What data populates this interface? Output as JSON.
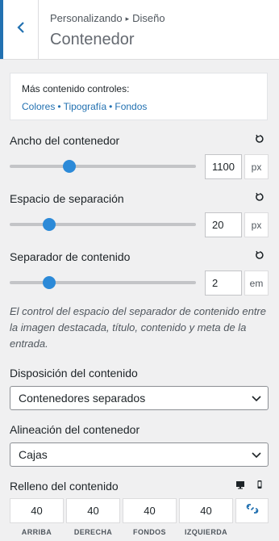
{
  "header": {
    "breadcrumb_parent": "Personalizando",
    "breadcrumb_child": "Diseño",
    "title": "Contenedor"
  },
  "info": {
    "label": "Más contenido controles:",
    "links": [
      "Colores",
      "Tipografía",
      "Fondos"
    ],
    "separator": "•"
  },
  "controls": [
    {
      "label": "Ancho del contenedor",
      "value": "1100",
      "unit": "px",
      "level": 0.32
    },
    {
      "label": "Espacio de separación",
      "value": "20",
      "unit": "px",
      "level": 0.21
    },
    {
      "label": "Separador de contenido",
      "value": "2",
      "unit": "em",
      "level": 0.21
    }
  ],
  "description": "El control del espacio del separador de contenido entre la imagen destacada, título, contenido y meta de la entrada.",
  "layout": {
    "label": "Disposición del contenido",
    "selected": "Contenedores separados"
  },
  "alignment": {
    "label": "Alineación del contenedor",
    "selected": "Cajas"
  },
  "padding": {
    "label": "Relleno del contenido",
    "values": [
      "40",
      "40",
      "40",
      "40"
    ],
    "sides": [
      "ARRIBA",
      "DERECHA",
      "FONDOS",
      "IZQUIERDA"
    ]
  },
  "colors": {
    "accent": "#2271b1",
    "thumb": "#2c8ad8",
    "background": "#f0f0f1"
  }
}
